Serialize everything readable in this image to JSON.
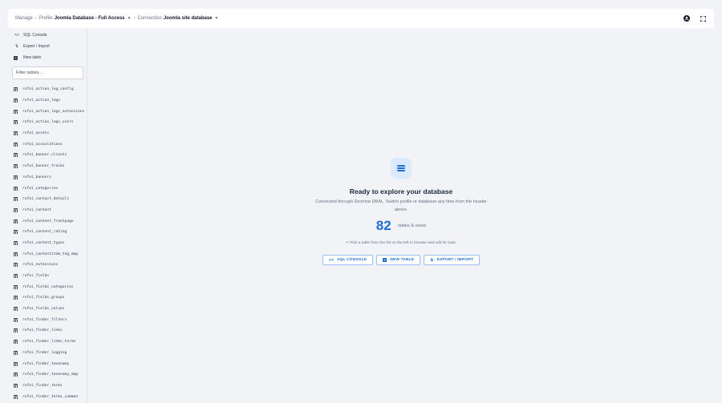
{
  "header": {
    "manage": "Manage",
    "profile_prefix": "Profile",
    "profile_name": "Joomla Database - Full Access",
    "connection_prefix": "Connection",
    "connection_name": "Joomla site database"
  },
  "sidebar": {
    "actions": [
      {
        "label": "SQL Console",
        "icon": "code-icon"
      },
      {
        "label": "Export / Import",
        "icon": "import-export-icon"
      },
      {
        "label": "New table",
        "icon": "plus-square-icon"
      }
    ],
    "filter_placeholder": "Filter tables...",
    "tables": [
      "rvfoi_action_log_config",
      "rvfoi_action_logs",
      "rvfoi_action_logs_extensions",
      "rvfoi_action_logs_users",
      "rvfoi_assets",
      "rvfoi_associations",
      "rvfoi_banner_clients",
      "rvfoi_banner_tracks",
      "rvfoi_banners",
      "rvfoi_categories",
      "rvfoi_contact_details",
      "rvfoi_content",
      "rvfoi_content_frontpage",
      "rvfoi_content_rating",
      "rvfoi_content_types",
      "rvfoi_contentitem_tag_map",
      "rvfoi_extensions",
      "rvfoi_fields",
      "rvfoi_fields_categories",
      "rvfoi_fields_groups",
      "rvfoi_fields_values",
      "rvfoi_finder_filters",
      "rvfoi_finder_links",
      "rvfoi_finder_links_terms",
      "rvfoi_finder_logging",
      "rvfoi_finder_taxonomy",
      "rvfoi_finder_taxonomy_map",
      "rvfoi_finder_terms",
      "rvfoi_finder_terms_common"
    ]
  },
  "main": {
    "title": "Ready to explore your database",
    "description": "Connected through Doctrine DBAL. Switch profile or database any time from the header above.",
    "count": "82",
    "count_label": "tables & views",
    "hint": "Pick a table from the list on the left to browse and edit its rows.",
    "buttons": {
      "sql": "SQL CONSOLE",
      "new_table": "NEW TABLE",
      "export": "EXPORT / IMPORT"
    }
  },
  "colors": {
    "accent": "#1d6fd6",
    "background": "#f1f3f6"
  }
}
